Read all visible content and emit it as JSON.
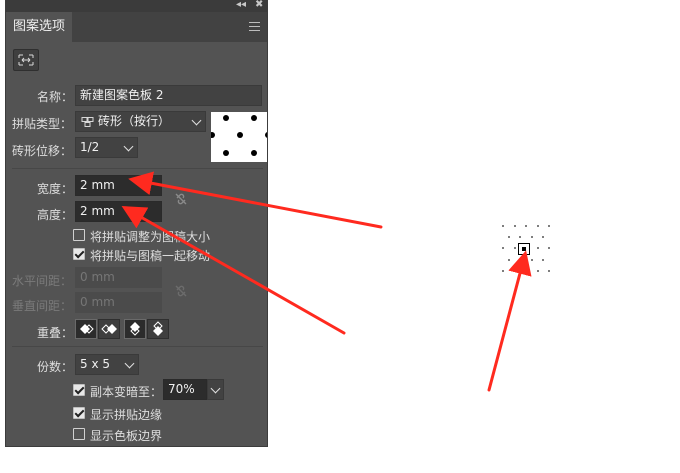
{
  "panel": {
    "collapse_glyph": "◂◂",
    "close_glyph": "✖",
    "tab_title": "图案选项",
    "name_label": "名称：",
    "name_value": "新建图案色板 2",
    "tile_type_label": "拼贴类型：",
    "tile_type_value": "砖形（按行）",
    "brick_offset_label": "砖形位移：",
    "brick_offset_value": "1/2",
    "width_label": "宽度：",
    "width_value": "2 mm",
    "height_label": "高度：",
    "height_value": "2 mm",
    "resize_tile_label": "将拼贴调整为图稿大小",
    "move_tile_label": "将拼贴与图稿一起移动",
    "h_spacing_label": "水平间距：",
    "h_spacing_value": "0 mm",
    "v_spacing_label": "垂直间距：",
    "v_spacing_value": "0 mm",
    "overlap_label": "重叠：",
    "copies_label": "份数：",
    "copies_value": "5 x 5",
    "dim_copies_label": "副本变暗至：",
    "dim_copies_value": "70%",
    "show_tile_edge_label": "显示拼贴边缘",
    "show_swatch_bounds_label": "显示色板边界"
  },
  "state": {
    "resize_tile_checked": false,
    "move_tile_checked": true,
    "dim_copies_checked": true,
    "show_tile_edge_checked": true,
    "show_swatch_bounds_checked": false
  },
  "colors": {
    "panel_bg": "#535353",
    "annotation_arrow": "#ff2a1f"
  }
}
